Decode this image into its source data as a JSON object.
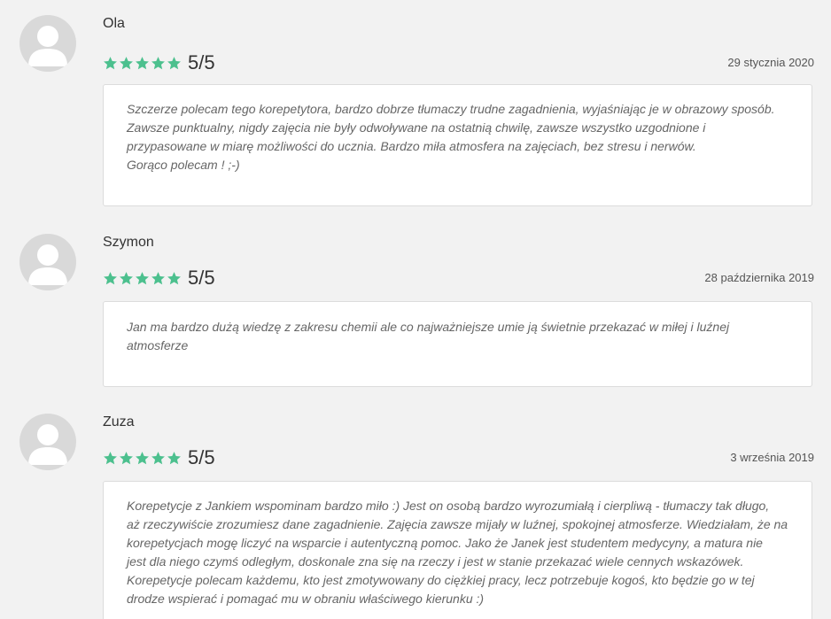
{
  "colors": {
    "star": "#4cc08e",
    "avatar_bg": "#d9d9d9",
    "avatar_fg": "#ffffff"
  },
  "reviews": [
    {
      "name": "Ola",
      "stars": 5,
      "score": "5/5",
      "date": "29 stycznia 2020",
      "avatar_icon": "user-avatar-icon",
      "text": "Szczerze polecam tego korepetytora, bardzo dobrze tłumaczy trudne zagadnienia, wyjaśniając je w obrazowy sposób.\nZawsze punktualny, nigdy zajęcia nie były odwoływane na ostatnią chwilę, zawsze wszystko uzgodnione i\nprzypasowane w miarę możliwości do ucznia. Bardzo miła atmosfera na zajęciach, bez stresu i nerwów.\nGorąco polecam ! ;-)"
    },
    {
      "name": "Szymon",
      "stars": 5,
      "score": "5/5",
      "date": "28 października 2019",
      "avatar_icon": "user-avatar-icon",
      "text": "Jan ma bardzo dużą wiedzę z zakresu chemii ale co najważniejsze umie ją świetnie przekazać w miłej i luźnej\natmosferze"
    },
    {
      "name": "Zuza",
      "stars": 5,
      "score": "5/5",
      "date": "3 września 2019",
      "avatar_icon": "user-avatar-icon",
      "text": "Korepetycje z Jankiem wspominam bardzo miło :) Jest on osobą bardzo wyrozumiałą i cierpliwą - tłumaczy tak długo,\naż rzeczywiście zrozumiesz dane zagadnienie. Zajęcia zawsze mijały w luźnej, spokojnej atmosferze. Wiedziałam, że na\nkorepetycjach mogę liczyć na wsparcie i autentyczną pomoc. Jako że Janek jest studentem medycyny, a matura nie\njest dla niego czymś odległym, doskonale zna się na rzeczy i jest w stanie przekazać wiele cennych wskazówek.\nKorepetycje polecam każdemu, kto jest zmotywowany do ciężkiej pracy, lecz potrzebuje kogoś, kto będzie go w tej\ndrodze wspierać i pomagać mu w obraniu właściwego kierunku :)"
    }
  ]
}
